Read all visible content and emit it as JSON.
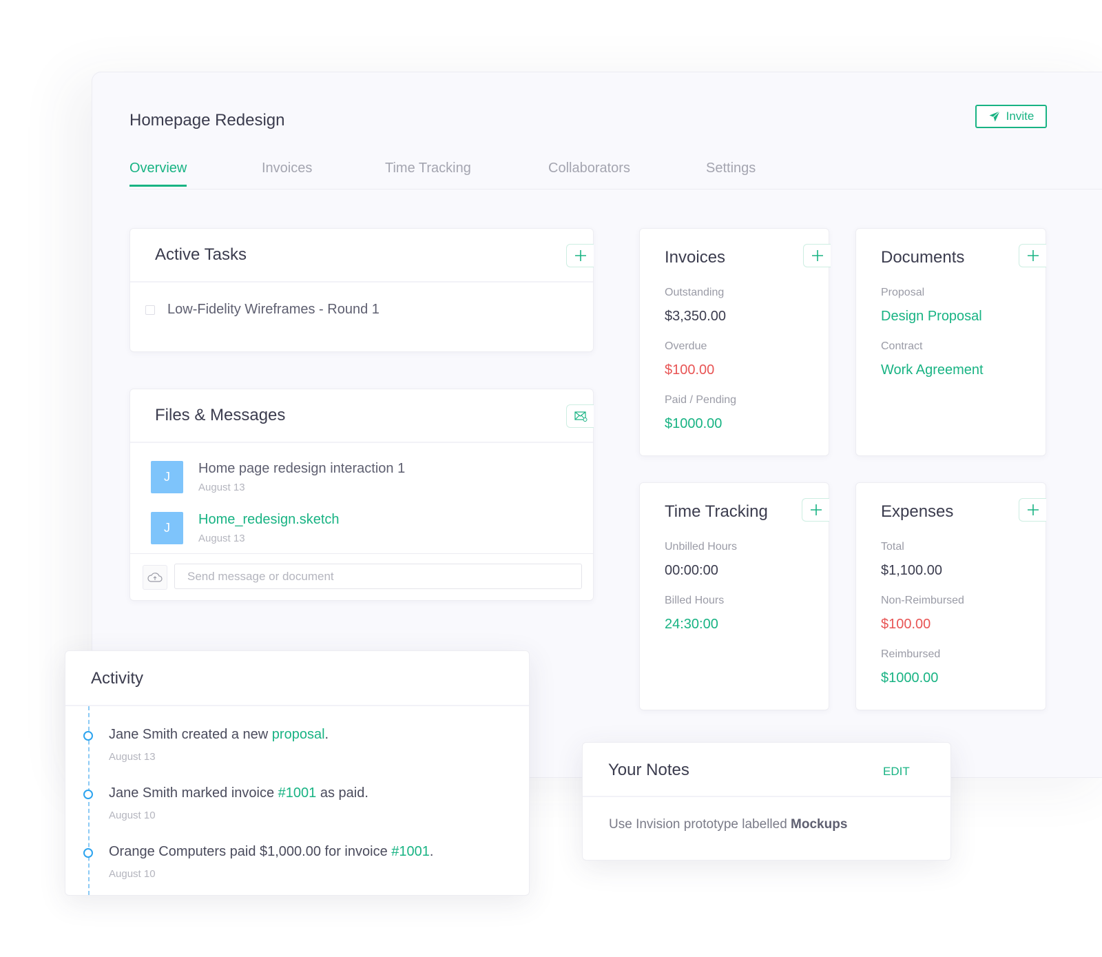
{
  "project": {
    "title": "Homepage Redesign",
    "invite_label": "Invite"
  },
  "tabs": [
    {
      "label": "Overview",
      "active": true
    },
    {
      "label": "Invoices",
      "active": false
    },
    {
      "label": "Time Tracking",
      "active": false
    },
    {
      "label": "Collaborators",
      "active": false
    },
    {
      "label": "Settings",
      "active": false
    }
  ],
  "active_tasks": {
    "title": "Active Tasks",
    "items": [
      {
        "label": "Low-Fidelity Wireframes - Round 1",
        "checked": false
      }
    ]
  },
  "files_messages": {
    "title": "Files & Messages",
    "items": [
      {
        "avatar": "J",
        "title": "Home page redesign interaction 1",
        "date": "August 13",
        "is_file": false
      },
      {
        "avatar": "J",
        "title": "Home_redesign.sketch",
        "date": "August 13",
        "is_file": true
      }
    ],
    "composer_placeholder": "Send message or document"
  },
  "invoices": {
    "title": "Invoices",
    "stats": [
      {
        "label": "Outstanding",
        "value": "$3,350.00",
        "tone": "default"
      },
      {
        "label": "Overdue",
        "value": "$100.00",
        "tone": "red"
      },
      {
        "label": "Paid / Pending",
        "value": "$1000.00",
        "tone": "green"
      }
    ]
  },
  "documents": {
    "title": "Documents",
    "stats": [
      {
        "label": "Proposal",
        "value": "Design Proposal",
        "tone": "link"
      },
      {
        "label": "Contract",
        "value": "Work Agreement",
        "tone": "link"
      }
    ]
  },
  "time_tracking": {
    "title": "Time Tracking",
    "stats": [
      {
        "label": "Unbilled Hours",
        "value": "00:00:00",
        "tone": "default"
      },
      {
        "label": "Billed Hours",
        "value": "24:30:00",
        "tone": "green"
      }
    ]
  },
  "expenses": {
    "title": "Expenses",
    "stats": [
      {
        "label": "Total",
        "value": "$1,100.00",
        "tone": "default"
      },
      {
        "label": "Non-Reimbursed",
        "value": "$100.00",
        "tone": "red"
      },
      {
        "label": "Reimbursed",
        "value": "$1000.00",
        "tone": "green"
      }
    ]
  },
  "activity": {
    "title": "Activity",
    "items": [
      {
        "before": "Jane Smith created a new ",
        "link": "proposal",
        "after": ".",
        "date": "August 13"
      },
      {
        "before": "Jane Smith marked invoice ",
        "link": "#1001",
        "after": " as paid.",
        "date": "August 10"
      },
      {
        "before": "Orange Computers paid $1,000.00 for invoice ",
        "link": "#1001",
        "after": ".",
        "date": "August 10"
      }
    ]
  },
  "notes": {
    "title": "Your Notes",
    "edit_label": "EDIT",
    "text_before": "Use Invision prototype labelled ",
    "text_bold": "Mockups"
  },
  "colors": {
    "accent": "#18b383",
    "danger": "#e85454",
    "avatar": "#7ec4fb",
    "timeline": "#2da4ef"
  }
}
